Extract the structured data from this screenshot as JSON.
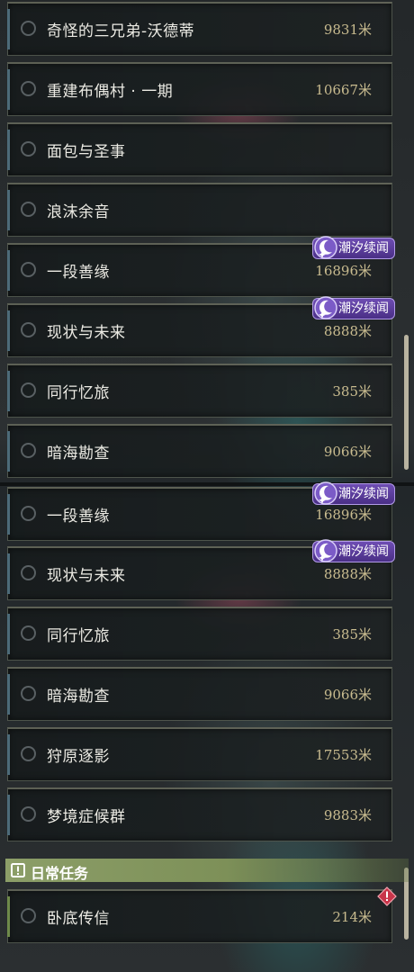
{
  "panel_top": {
    "quests": [
      {
        "title": "奇怪的三兄弟-沃德蒂",
        "distance": "9831米"
      },
      {
        "title": "重建布偶村 · 一期",
        "distance": "10667米"
      },
      {
        "title": "面包与圣事",
        "distance": ""
      },
      {
        "title": "浪沫余音",
        "distance": ""
      },
      {
        "title": "一段善缘",
        "distance": "16896米",
        "badge": "潮汐续闻"
      },
      {
        "title": "现状与未来",
        "distance": "8888米",
        "badge": "潮汐续闻"
      },
      {
        "title": "同行忆旅",
        "distance": "385米"
      },
      {
        "title": "暗海勘查",
        "distance": "9066米"
      }
    ]
  },
  "panel_bottom": {
    "quests": [
      {
        "title": "一段善缘",
        "distance": "16896米",
        "badge": "潮汐续闻"
      },
      {
        "title": "现状与未来",
        "distance": "8888米",
        "badge": "潮汐续闻"
      },
      {
        "title": "同行忆旅",
        "distance": "385米"
      },
      {
        "title": "暗海勘查",
        "distance": "9066米"
      },
      {
        "title": "狩原逐影",
        "distance": "17553米"
      },
      {
        "title": "梦境症候群",
        "distance": "9883米"
      }
    ],
    "daily_section": {
      "title": "日常任务",
      "quests": [
        {
          "title": "卧底传信",
          "distance": "214米"
        }
      ]
    }
  },
  "colors": {
    "badge": "#5a3d9c",
    "distance": "#c8bb8f",
    "daily_header": "#8c9e68",
    "alert": "#c8354a"
  }
}
